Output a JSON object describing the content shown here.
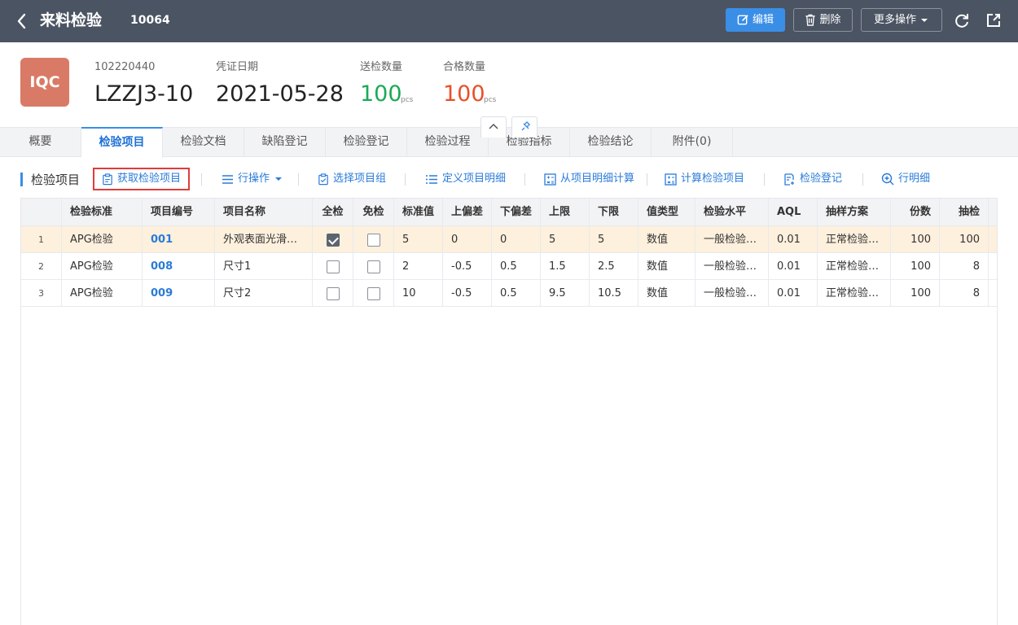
{
  "topbar": {
    "title": "来料检验",
    "doc_no": "10064",
    "edit_label": "编辑",
    "delete_label": "删除",
    "more_label": "更多操作",
    "bg_color": "#4b5462",
    "accent": "#3a8ee6"
  },
  "header": {
    "badge": "IQC",
    "badge_color": "#d97a66",
    "code_label": "102220440",
    "code_value": "LZZJ3-10",
    "date_label": "凭证日期",
    "date_value": "2021-05-28",
    "sent_label": "送检数量",
    "sent_value": "100",
    "sent_unit": "pcs",
    "sent_color": "#1aaa55",
    "pass_label": "合格数量",
    "pass_value": "100",
    "pass_unit": "pcs",
    "pass_color": "#e8502a"
  },
  "tabs": [
    {
      "label": "概要"
    },
    {
      "label": "检验项目",
      "active": true
    },
    {
      "label": "检验文档"
    },
    {
      "label": "缺陷登记"
    },
    {
      "label": "检验登记"
    },
    {
      "label": "检验过程"
    },
    {
      "label": "检验指标"
    },
    {
      "label": "检验结论"
    },
    {
      "label": "附件(0)"
    }
  ],
  "toolbar": {
    "section_title": "检验项目",
    "fetch_items": "获取检验项目",
    "row_ops": "行操作",
    "select_group": "选择项目组",
    "define_detail": "定义项目明细",
    "calc_from_detail": "从项目明细计算",
    "calc_items": "计算检验项目",
    "inspect_register": "检验登记",
    "row_detail": "行明细"
  },
  "table": {
    "columns": [
      "检验标准",
      "项目编号",
      "项目名称",
      "全检",
      "免检",
      "标准值",
      "上偏差",
      "下偏差",
      "上限",
      "下限",
      "值类型",
      "检验水平",
      "AQL",
      "抽样方案",
      "份数",
      "抽检"
    ],
    "rows": [
      {
        "idx": "1",
        "standard": "APG检验",
        "code": "001",
        "name": "外观表面光滑…",
        "full": true,
        "exempt": false,
        "std": "5",
        "upper_dev": "0",
        "lower_dev": "0",
        "upper": "5",
        "lower": "5",
        "vtype": "数值",
        "level": "一般检验…",
        "aql": "0.01",
        "plan": "正常检验…",
        "copies": "100",
        "sample": "100"
      },
      {
        "idx": "2",
        "standard": "APG检验",
        "code": "008",
        "name": "尺寸1",
        "full": false,
        "exempt": false,
        "std": "2",
        "upper_dev": "-0.5",
        "lower_dev": "0.5",
        "upper": "1.5",
        "lower": "2.5",
        "vtype": "数值",
        "level": "一般检验…",
        "aql": "0.01",
        "plan": "正常检验…",
        "copies": "100",
        "sample": "8"
      },
      {
        "idx": "3",
        "standard": "APG检验",
        "code": "009",
        "name": "尺寸2",
        "full": false,
        "exempt": false,
        "std": "10",
        "upper_dev": "-0.5",
        "lower_dev": "0.5",
        "upper": "9.5",
        "lower": "10.5",
        "vtype": "数值",
        "level": "一般检验…",
        "aql": "0.01",
        "plan": "正常检验…",
        "copies": "100",
        "sample": "8"
      }
    ]
  }
}
